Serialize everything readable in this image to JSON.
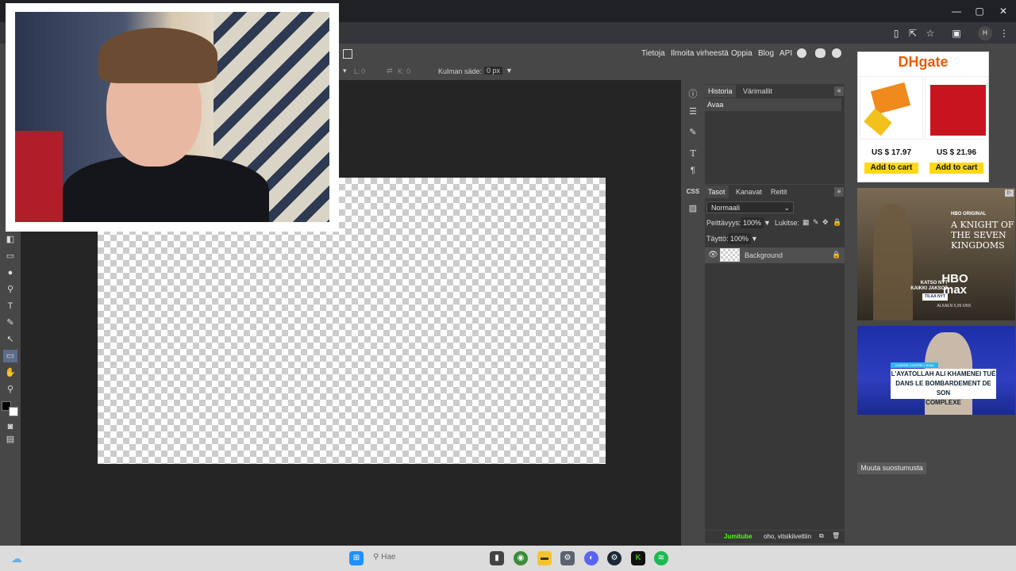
{
  "browser": {
    "window_controls": [
      "—",
      "▢",
      "✕"
    ],
    "toolbar_icons": [
      "bookmark-icon",
      "share-icon",
      "star-icon",
      "extension-icon",
      "profile-icon",
      "menu-icon"
    ],
    "profile_initial": "H",
    "menu_glyph": "⋮"
  },
  "top_menu": {
    "links": [
      "Tietoja",
      "Ilmoita virheestä",
      "Oppia",
      "Blog",
      "API"
    ],
    "social_icons": [
      "reddit-icon",
      "twitter-icon",
      "facebook-icon"
    ]
  },
  "tool_options": {
    "w_label": "L:",
    "w_value": "0",
    "h_label": "K:",
    "h_value": "0",
    "radius_label": "Kulman säde:",
    "radius_value": "0 px"
  },
  "history_panel": {
    "tabs": [
      "Historia",
      "Värimallit"
    ],
    "active_tab": "Historia",
    "items": [
      "Avaa"
    ]
  },
  "layers_panel": {
    "tabs": [
      "Tasot",
      "Kanavat",
      "Reitit"
    ],
    "active_tab": "Tasot",
    "blend_mode": "Normaali",
    "opacity_label": "Peittävyys:",
    "opacity_value": "100%",
    "lock_label": "Lukitse:",
    "fill_label": "Täyttö:",
    "fill_value": "100%",
    "layers": [
      {
        "name": "Background",
        "visible": true,
        "locked": true
      }
    ]
  },
  "side_icons": [
    "info-icon",
    "adjust-icon",
    "brush-icon",
    "type-icon",
    "paragraph-icon",
    "css-icon",
    "image-icon"
  ],
  "css_label": "CSS",
  "bottom_bar": {
    "text": "Jumitube",
    "subtext": "oho, vitsikiivettiin"
  },
  "ads": {
    "dhgate": {
      "logo": "DHgate",
      "prices": [
        "US $ 17.97",
        "US $ 21.96"
      ],
      "cta": "Add to cart"
    },
    "hbo": {
      "badge": "HBO ORIGINAL",
      "title": "A KNIGHT OF THE SEVEN KINGDOMS",
      "brand": "HBO max",
      "line1": "KATSO NYT",
      "line2": "KAIKKI JAKSOT",
      "cta": "TILAA NYT",
      "price": "ALKAEN 6,99 €/KK"
    },
    "news": {
      "tag": "GUERRE CONTRE L'IRAN",
      "headline1": "L'AYATOLLAH ALI KHAMENEI TUÉ",
      "headline2": "DANS LE BOMBARDEMENT DE SON",
      "headline3": "COMPLEXE"
    },
    "consent": "Muuta suostumusta"
  },
  "taskbar": {
    "search": "Hae",
    "icons": [
      "weather-icon",
      "windows-icon",
      "search-icon",
      "files-icon",
      "chrome-icon",
      "explorer-icon",
      "settings-icon",
      "discord-icon",
      "steam-icon",
      "kick-icon",
      "spotify-icon"
    ]
  }
}
